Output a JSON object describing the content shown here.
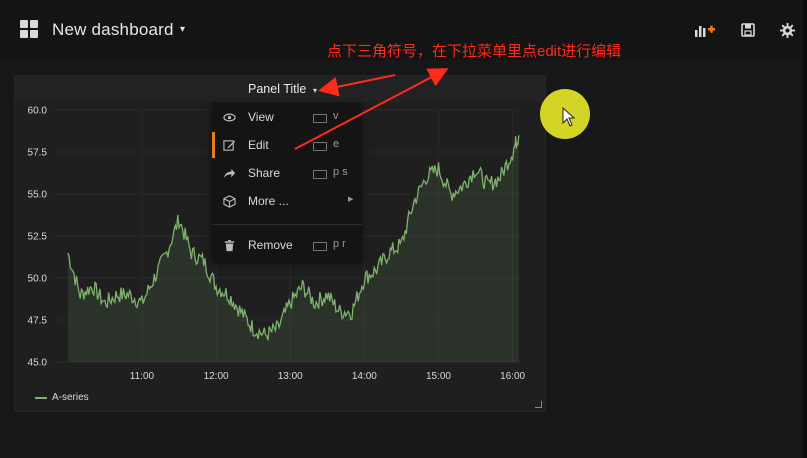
{
  "header": {
    "title": "New dashboard",
    "caret": "▾",
    "buttons": [
      "add-panel-icon",
      "save-icon",
      "settings-icon"
    ]
  },
  "annotation": {
    "text": "点下三角符号，在下拉菜单里点edit进行编辑",
    "color": "#ff2a1a"
  },
  "panel": {
    "title": "Panel Title",
    "caret": "▾"
  },
  "menu": {
    "items": [
      {
        "label": "View",
        "shortcut": "v",
        "icon": "eye-icon"
      },
      {
        "label": "Edit",
        "shortcut": "e",
        "icon": "edit-icon"
      },
      {
        "label": "Share",
        "shortcut": "p s",
        "icon": "share-icon"
      },
      {
        "label": "More ...",
        "shortcut": "",
        "icon": "cube-icon"
      },
      {
        "label": "Remove",
        "shortcut": "p r",
        "icon": "trash-icon"
      }
    ],
    "active": "Edit",
    "accent": "#eb7b18"
  },
  "legend": {
    "label": "A-series",
    "color": "#7eb26d"
  },
  "chart_data": {
    "type": "line",
    "y_ticks": [
      "60.0",
      "57.5",
      "55.0",
      "52.5",
      "50.0",
      "47.5",
      "45.0"
    ],
    "x_ticks": [
      "11:00",
      "12:00",
      "13:00",
      "14:00",
      "15:00",
      "16:00"
    ],
    "ylim": [
      45,
      60
    ],
    "grid": true,
    "series": [
      {
        "name": "A-series",
        "x": [
          "10:00",
          "10:10",
          "10:20",
          "10:30",
          "10:40",
          "10:50",
          "11:00",
          "11:10",
          "11:20",
          "11:30",
          "11:40",
          "11:50",
          "12:00",
          "12:10",
          "12:20",
          "12:30",
          "12:40",
          "12:50",
          "13:00",
          "13:10",
          "13:20",
          "13:30",
          "13:40",
          "13:50",
          "14:00",
          "14:10",
          "14:20",
          "14:30",
          "14:40",
          "14:50",
          "15:00",
          "15:10",
          "15:20",
          "15:30",
          "15:40",
          "15:50",
          "16:00",
          "16:05"
        ],
        "values": [
          51.5,
          49.0,
          49.5,
          48.5,
          49.0,
          49.0,
          48.5,
          50.0,
          51.5,
          53.5,
          51.5,
          51.0,
          49.5,
          49.0,
          48.0,
          47.0,
          46.6,
          47.0,
          48.5,
          49.5,
          48.5,
          49.0,
          48.0,
          48.0,
          50.0,
          50.5,
          51.5,
          52.0,
          54.5,
          56.0,
          56.5,
          55.0,
          55.5,
          56.5,
          55.5,
          56.0,
          57.5,
          58.5
        ]
      }
    ]
  }
}
